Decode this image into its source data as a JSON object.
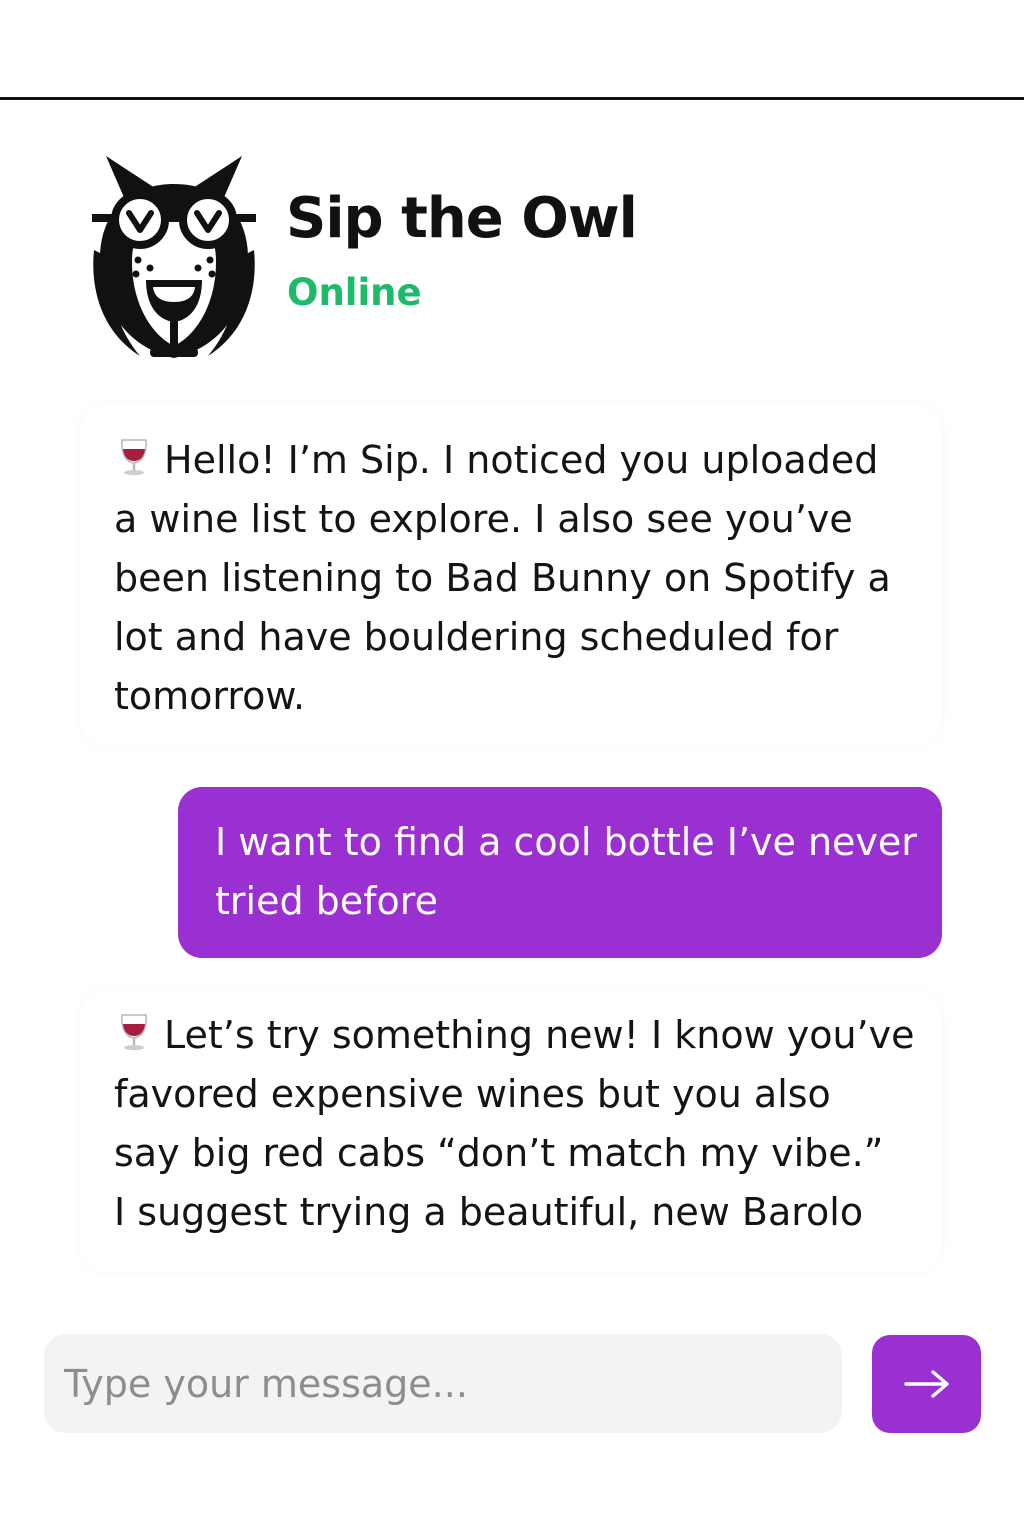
{
  "header": {
    "bot_name": "Sip the Owl",
    "status": "Online",
    "avatar_icon": "owl-with-wine-glass-icon"
  },
  "messages": [
    {
      "sender": "bot",
      "icon": "wine-glass-icon",
      "lines": [
        "Hello! I’m Sip. I noticed you uploaded",
        "a wine list to explore. I also see you’ve",
        "been listening to Bad Bunny on Spotify a",
        "lot and have bouldering scheduled for",
        "tomorrow."
      ]
    },
    {
      "sender": "user",
      "lines": [
        "I want to find a cool bottle I’ve never",
        "tried before"
      ]
    },
    {
      "sender": "bot",
      "icon": "wine-glass-icon",
      "lines": [
        "Let’s try something new! I know you’ve",
        "favored expensive wines but you also",
        "say big red cabs “don’t match my vibe.”",
        "I suggest trying a beautiful, new Barolo"
      ]
    }
  ],
  "composer": {
    "placeholder": "Type your message...",
    "value": ""
  },
  "send_button": {
    "icon": "arrow-right-icon"
  },
  "colors": {
    "accent": "#9a2fd2",
    "status_online": "#1dba6a",
    "text": "#111111",
    "input_background": "#f3f3f3"
  }
}
